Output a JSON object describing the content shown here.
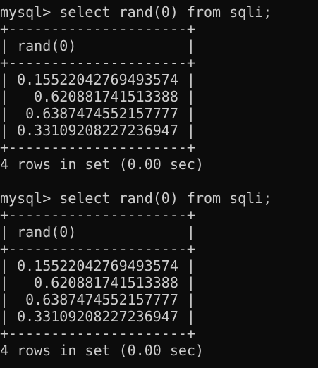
{
  "blocks": [
    {
      "prompt": "mysql>",
      "command": " select rand(0) from sqli;",
      "border_top": "+---------------------+",
      "header_row": "| rand(0)             |",
      "border_mid": "+---------------------+",
      "rows": [
        "| 0.15522042769493574 |",
        "|   0.620881741513388 |",
        "|  0.6387474552157777 |",
        "| 0.33109208227236947 |"
      ],
      "border_bottom": "+---------------------+",
      "summary": "4 rows in set (0.00 sec)"
    },
    {
      "prompt": "mysql>",
      "command": " select rand(0) from sqli;",
      "border_top": "+---------------------+",
      "header_row": "| rand(0)             |",
      "border_mid": "+---------------------+",
      "rows": [
        "| 0.15522042769493574 |",
        "|   0.620881741513388 |",
        "|  0.6387474552157777 |",
        "| 0.33109208227236947 |"
      ],
      "border_bottom": "+---------------------+",
      "summary": "4 rows in set (0.00 sec)"
    }
  ]
}
